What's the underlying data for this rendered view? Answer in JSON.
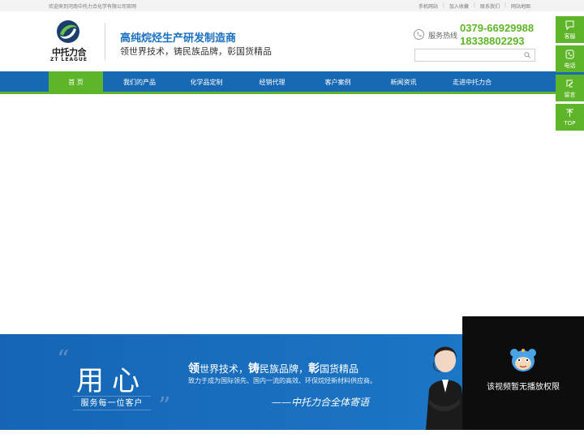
{
  "topbar": {
    "welcome": "欢迎来到河南中托力合化学有限公司官网",
    "links": [
      "手机网站",
      "加入收藏",
      "联系我们",
      "网站地图"
    ]
  },
  "header": {
    "logo_cn": "中托力合",
    "logo_en": "ZT LEAGUE",
    "slogan_main": "高纯烷烃生产研发制造商",
    "slogan_sub": "领世界技术，铸民族品牌，彰国货精品",
    "hotline_label": "服务热线",
    "phone_1": "0379-66929988",
    "phone_2": "18338802293",
    "search_placeholder": ""
  },
  "nav": {
    "items": [
      "首 页",
      "我们的产品",
      "化学品定制",
      "经销代理",
      "客户案例",
      "新闻资讯",
      "走进中托力合"
    ],
    "active_index": 0
  },
  "banner": {
    "big_text": "用心",
    "serve_text": "服务每一位客户",
    "line1_b1": "领",
    "line1_t1": "世界技术，",
    "line1_b2": "铸",
    "line1_t2": "民族品牌，",
    "line1_b3": "彰",
    "line1_t3": "国货精品",
    "line2": "致力于成为国际领先、国内一流的高效、环保烷烃新材料供应商。",
    "signature": "——中托力合全体寄语"
  },
  "side": {
    "service_label": "客服",
    "phone_label": "电话",
    "message_label": "留言",
    "top_label": "TOP"
  },
  "video": {
    "message": "该视频暂无播放权限"
  },
  "colors": {
    "brand_blue": "#1869b4",
    "brand_green": "#5fb52a",
    "phone_green": "#5eb626"
  }
}
